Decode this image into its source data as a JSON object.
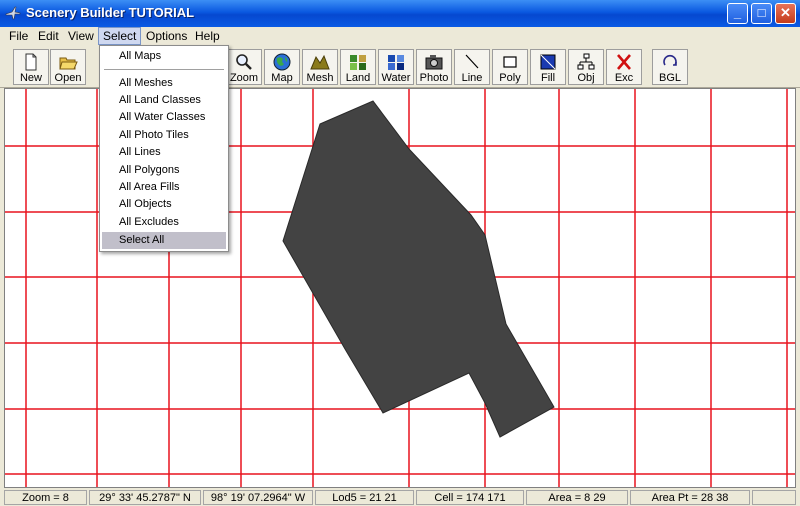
{
  "window": {
    "title": "Scenery Builder  TUTORIAL",
    "min_glyph": "_",
    "max_glyph": "□",
    "close_glyph": "✕"
  },
  "menu": [
    "File",
    "Edit",
    "View",
    "Select",
    "Options",
    "Help"
  ],
  "toolbar": [
    {
      "label": "New",
      "icon": "new-file-icon"
    },
    {
      "label": "Open",
      "icon": "open-folder-icon"
    },
    {
      "label": "Zoom",
      "icon": "magnifier-icon"
    },
    {
      "label": "Map",
      "icon": "globe-icon"
    },
    {
      "label": "Mesh",
      "icon": "mesh-icon"
    },
    {
      "label": "Land",
      "icon": "land-icon"
    },
    {
      "label": "Water",
      "icon": "water-icon"
    },
    {
      "label": "Photo",
      "icon": "camera-icon"
    },
    {
      "label": "Line",
      "icon": "line-icon"
    },
    {
      "label": "Poly",
      "icon": "polygon-icon"
    },
    {
      "label": "Fill",
      "icon": "fill-icon"
    },
    {
      "label": "Obj",
      "icon": "object-icon"
    },
    {
      "label": "Exc",
      "icon": "exclude-icon"
    },
    {
      "label": "BGL",
      "icon": "compile-icon"
    }
  ],
  "select_menu": {
    "items": [
      "All Maps",
      "All Meshes",
      "All Land Classes",
      "All Water Classes",
      "All Photo Tiles",
      "All Lines",
      "All Polygons",
      "All Area Fills",
      "All Objects",
      "All Excludes",
      "Select All"
    ],
    "highlighted": "Select All"
  },
  "status": [
    "Zoom = 8",
    "29° 33' 45.2787\" N",
    "98° 19' 07.2964\" W",
    "Lod5 = 21 21",
    "Cell = 174 171",
    "Area = 8 29",
    "Area Pt = 28 38"
  ],
  "colors": {
    "grid": "#e8141e",
    "polygon_fill": "#434343",
    "polygon_stroke": "#2a2a2a",
    "title_bar": "#0a58e0"
  }
}
